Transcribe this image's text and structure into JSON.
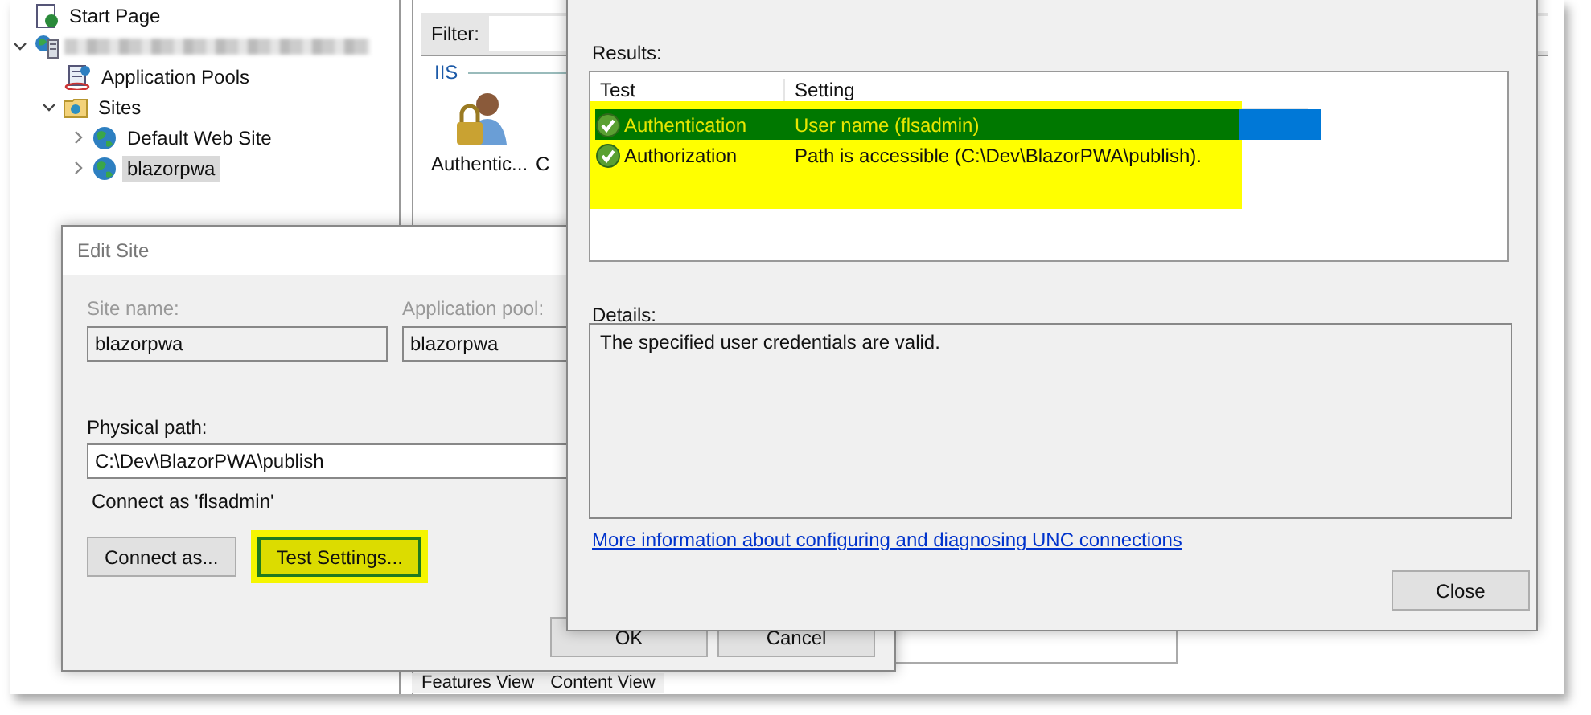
{
  "tree": {
    "items": [
      {
        "label": "Start Page",
        "kind": "page"
      },
      {
        "kind": "server",
        "expanded": true,
        "children": [
          {
            "label": "Application Pools",
            "kind": "pools"
          },
          {
            "label": "Sites",
            "kind": "folder",
            "expanded": true,
            "children": [
              {
                "label": "Default Web Site",
                "kind": "site",
                "expanded": false,
                "selected": false
              },
              {
                "label": "blazorpwa",
                "kind": "site",
                "expanded": false,
                "selected": true
              }
            ]
          }
        ]
      }
    ]
  },
  "features": {
    "filter_label": "Filter:",
    "group": "IIS",
    "items": [
      {
        "label": "Authentic...",
        "kind": "auth"
      },
      {
        "label": "C",
        "kind": "text"
      }
    ]
  },
  "view_tabs": [
    "Features View",
    "Content View"
  ],
  "edit_site": {
    "title": "Edit Site",
    "site_name": {
      "label": "Site name:",
      "value": "blazorpwa",
      "disabled": true
    },
    "app_pool": {
      "label": "Application pool:",
      "value": "blazorpwa",
      "disabled": true
    },
    "physical_path": {
      "label": "Physical path:",
      "value": "C:\\Dev\\BlazorPWA\\publish"
    },
    "connect_as_text": "Connect as 'flsadmin'",
    "buttons": [
      {
        "label": "Connect as...",
        "highlighted": false
      },
      {
        "label": "Test Settings...",
        "highlighted": true
      }
    ],
    "footer_buttons": [
      "OK",
      "Cancel"
    ]
  },
  "test_connection": {
    "results_label": "Results:",
    "columns": [
      "Test",
      "Setting"
    ],
    "highlighted": true,
    "rows": [
      {
        "test": "Authentication",
        "setting": "User name (flsadmin)",
        "selected": true
      },
      {
        "test": "Authorization",
        "setting": "Path is accessible (C:\\Dev\\BlazorPWA\\publish).",
        "selected": false
      }
    ],
    "details_label": "Details:",
    "details_text": "The specified user credentials are valid.",
    "link": "More information about configuring and diagnosing UNC connections",
    "close_button": "Close"
  }
}
